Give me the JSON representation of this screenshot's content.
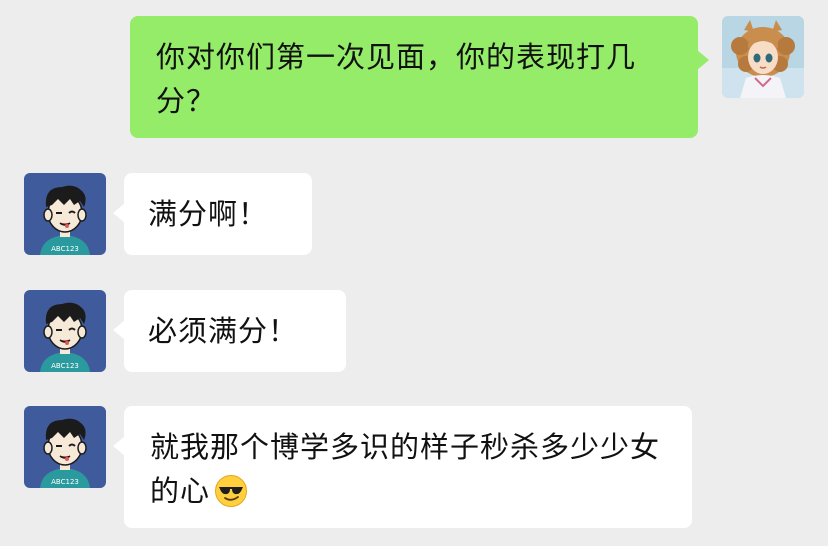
{
  "chat": {
    "messages": [
      {
        "sender": "me",
        "text": "你对你们第一次见面，你的表现打几分？"
      },
      {
        "sender": "them",
        "text": "满分啊！"
      },
      {
        "sender": "them",
        "text": "必须满分！"
      },
      {
        "sender": "them",
        "text": "就我那个博学多识的样子秒杀多少少女的心",
        "emoji": "sunglasses-emoji"
      }
    ]
  },
  "colors": {
    "background": "#ededed",
    "my_bubble": "#95ec69",
    "their_bubble": "#ffffff",
    "their_avatar_bg": "#3f5b9c"
  },
  "icons": {
    "my_avatar": "anime-girl-avatar",
    "their_avatar": "cartoon-boy-avatar",
    "emoji": "sunglasses-emoji"
  }
}
